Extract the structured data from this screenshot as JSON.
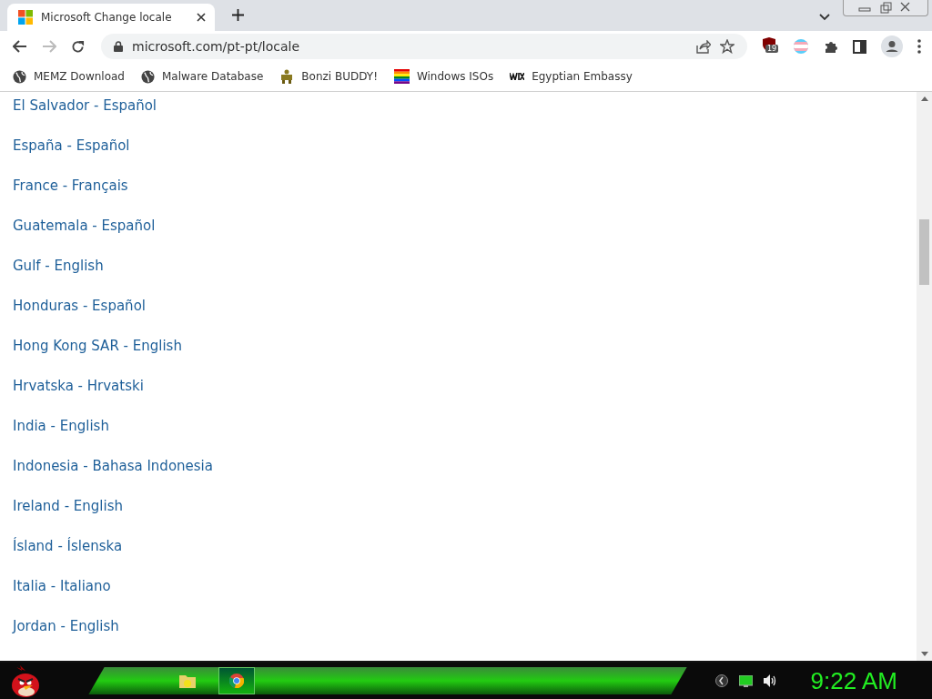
{
  "tab": {
    "title": "Microsoft Change locale",
    "selected": true
  },
  "address": {
    "url": "microsoft.com/pt-pt/locale"
  },
  "extension_badge": "19",
  "bookmarks": [
    {
      "label": "MEMZ Download",
      "kind": "globe"
    },
    {
      "label": "Malware Database",
      "kind": "globe"
    },
    {
      "label": "Bonzi BUDDY!",
      "kind": "figure"
    },
    {
      "label": "Windows ISOs",
      "kind": "rainbow"
    },
    {
      "label": "Egyptian Embassy",
      "kind": "wix"
    }
  ],
  "locales": [
    "El Salvador - Español",
    "España - Español",
    "France - Français",
    "Guatemala - Español",
    "Gulf - English",
    "Honduras - Español",
    "Hong Kong SAR - English",
    "Hrvatska - Hrvatski",
    "India - English",
    "Indonesia - Bahasa Indonesia",
    "Ireland - English",
    "Ísland - Íslenska",
    "Italia - Italiano",
    "Jordan - English"
  ],
  "taskbar": {
    "clock": "9:22 AM",
    "apps": [
      {
        "kind": "folder",
        "selected": false
      },
      {
        "kind": "chrome",
        "selected": true
      }
    ]
  }
}
